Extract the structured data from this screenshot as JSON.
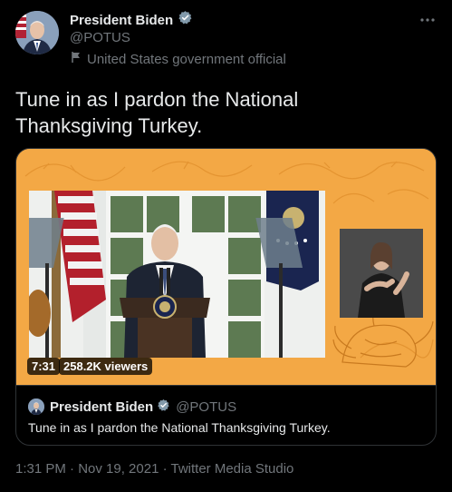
{
  "author": {
    "name": "President Biden",
    "handle": "@POTUS",
    "affiliation": "United States government official"
  },
  "tweet": {
    "text": "Tune in as I pardon the National Thanksgiving Turkey."
  },
  "media": {
    "duration": "7:31",
    "viewers": "258.2K viewers"
  },
  "quoted_tweet": {
    "name": "President Biden",
    "handle": "@POTUS",
    "text": "Tune in as I pardon the National Thanksgiving Turkey."
  },
  "meta": {
    "timestamp": "1:31 PM · Nov 19, 2021 · Twitter Media Studio"
  },
  "colors": {
    "background": "#000000",
    "primary_text": "#e7e9ea",
    "secondary_text": "#71767b",
    "border": "#2f3336",
    "media_orange": "#f3a845"
  },
  "icons": {
    "verified": "verified-badge-icon",
    "affiliation": "flag-icon",
    "more": "more-icon"
  }
}
